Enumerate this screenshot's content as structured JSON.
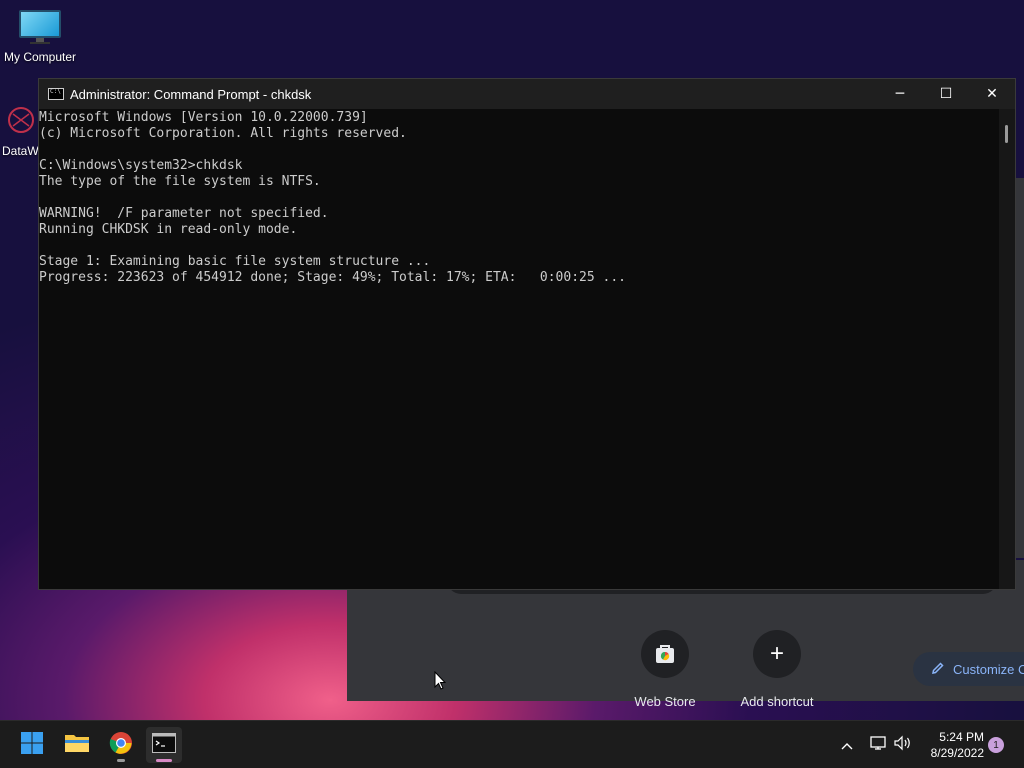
{
  "desktop": {
    "icons": [
      {
        "label": "My Computer",
        "icon": "monitor-icon"
      },
      {
        "label": "DataW",
        "icon": "shortcut-icon"
      }
    ]
  },
  "cmd_window": {
    "title": "Administrator: Command Prompt - chkdsk",
    "icon": "cmd-icon",
    "controls": {
      "minimize": "─",
      "maximize": "☐",
      "close": "✕"
    },
    "console_lines": [
      "Microsoft Windows [Version 10.0.22000.739]",
      "(c) Microsoft Corporation. All rights reserved.",
      "",
      "C:\\Windows\\system32>chkdsk",
      "The type of the file system is NTFS.",
      "",
      "WARNING!  /F parameter not specified.",
      "Running CHKDSK in read-only mode.",
      "",
      "Stage 1: Examining basic file system structure ...",
      "Progress: 223623 of 454912 done; Stage: 49%; Total: 17%; ETA:   0:00:25 ..."
    ]
  },
  "browser_behind": {
    "shortcuts": [
      {
        "label": "Web Store",
        "icon": "web-store-icon"
      },
      {
        "label": "Add shortcut",
        "glyph": "+"
      }
    ],
    "customize_label": "Customize C",
    "customize_icon": "pencil-icon"
  },
  "taskbar": {
    "apps": [
      {
        "name": "start",
        "icon": "windows-logo-icon"
      },
      {
        "name": "file-explorer",
        "icon": "folder-icon"
      },
      {
        "name": "chrome",
        "icon": "chrome-icon"
      },
      {
        "name": "terminal",
        "icon": "terminal-icon"
      }
    ],
    "tray": {
      "chevron": "^"
    },
    "clock": {
      "time": "5:24 PM",
      "date": "8/29/2022"
    },
    "notification_count": "1"
  }
}
